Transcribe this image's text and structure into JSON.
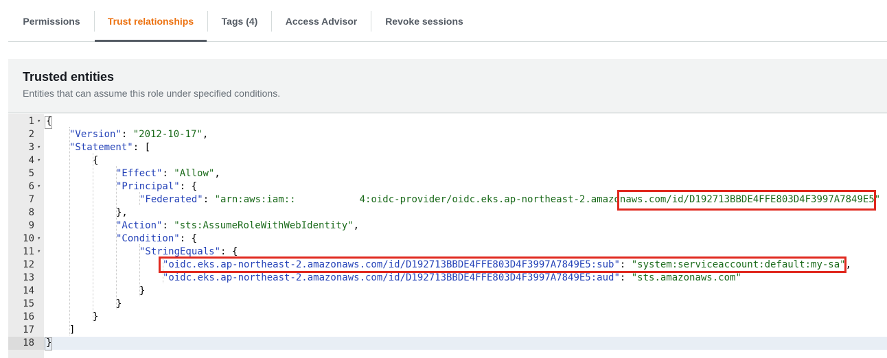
{
  "tabs": [
    {
      "label": "Permissions",
      "active": false
    },
    {
      "label": "Trust relationships",
      "active": true
    },
    {
      "label": "Tags (4)",
      "active": false
    },
    {
      "label": "Access Advisor",
      "active": false
    },
    {
      "label": "Revoke sessions",
      "active": false
    }
  ],
  "colors": {
    "accent": "#ec7211",
    "highlight_box": "#e0281e",
    "json_key": "#2442b8",
    "json_string": "#1a6a1a"
  },
  "panel": {
    "title": "Trusted entities",
    "description": "Entities that can assume this role under specified conditions."
  },
  "editor": {
    "line_numbers": [
      "1",
      "2",
      "3",
      "4",
      "5",
      "6",
      "7",
      "8",
      "9",
      "10",
      "11",
      "12",
      "13",
      "14",
      "15",
      "16",
      "17",
      "18"
    ],
    "fold_icon": "fold-caret-icon",
    "lines": {
      "l1": {
        "brace": "{"
      },
      "l2": {
        "key": "\"Version\"",
        "colon": ": ",
        "value": "\"2012-10-17\"",
        "tail": ","
      },
      "l3": {
        "key": "\"Statement\"",
        "tail": ": ["
      },
      "l4": {
        "brace": "{"
      },
      "l5": {
        "key": "\"Effect\"",
        "colon": ": ",
        "value": "\"Allow\"",
        "tail": ","
      },
      "l6": {
        "key": "\"Principal\"",
        "tail": ": {"
      },
      "l7": {
        "key": "\"Federated\"",
        "colon": ": ",
        "value_start": "\"arn:aws:iam::",
        "value_end": "4:oidc-provider/oidc.eks.ap-northeast-2.amazonaws.com/id/D192713BBDE4FFE803D4F3997A7849E5\""
      },
      "l8": {
        "brace": "},"
      },
      "l9": {
        "key": "\"Action\"",
        "colon": ": ",
        "value": "\"sts:AssumeRoleWithWebIdentity\"",
        "tail": ","
      },
      "l10": {
        "key": "\"Condition\"",
        "tail": ": {"
      },
      "l11": {
        "key": "\"StringEquals\"",
        "tail": ": {"
      },
      "l12": {
        "key": "\"oidc.eks.ap-northeast-2.amazonaws.com/id/D192713BBDE4FFE803D4F3997A7849E5:sub\"",
        "colon": ": ",
        "value": "\"system:serviceaccount:default:my-sa\"",
        "tail": ","
      },
      "l13": {
        "key": "\"oidc.eks.ap-northeast-2.amazonaws.com/id/D192713BBDE4FFE803D4F3997A7849E5:aud\"",
        "colon": ": ",
        "value": "\"sts.amazonaws.com\""
      },
      "l14": {
        "brace": "}"
      },
      "l15": {
        "brace": "}"
      },
      "l16": {
        "brace": "}"
      },
      "l17": {
        "brace": "]"
      },
      "l18": {
        "brace": "}"
      }
    }
  }
}
